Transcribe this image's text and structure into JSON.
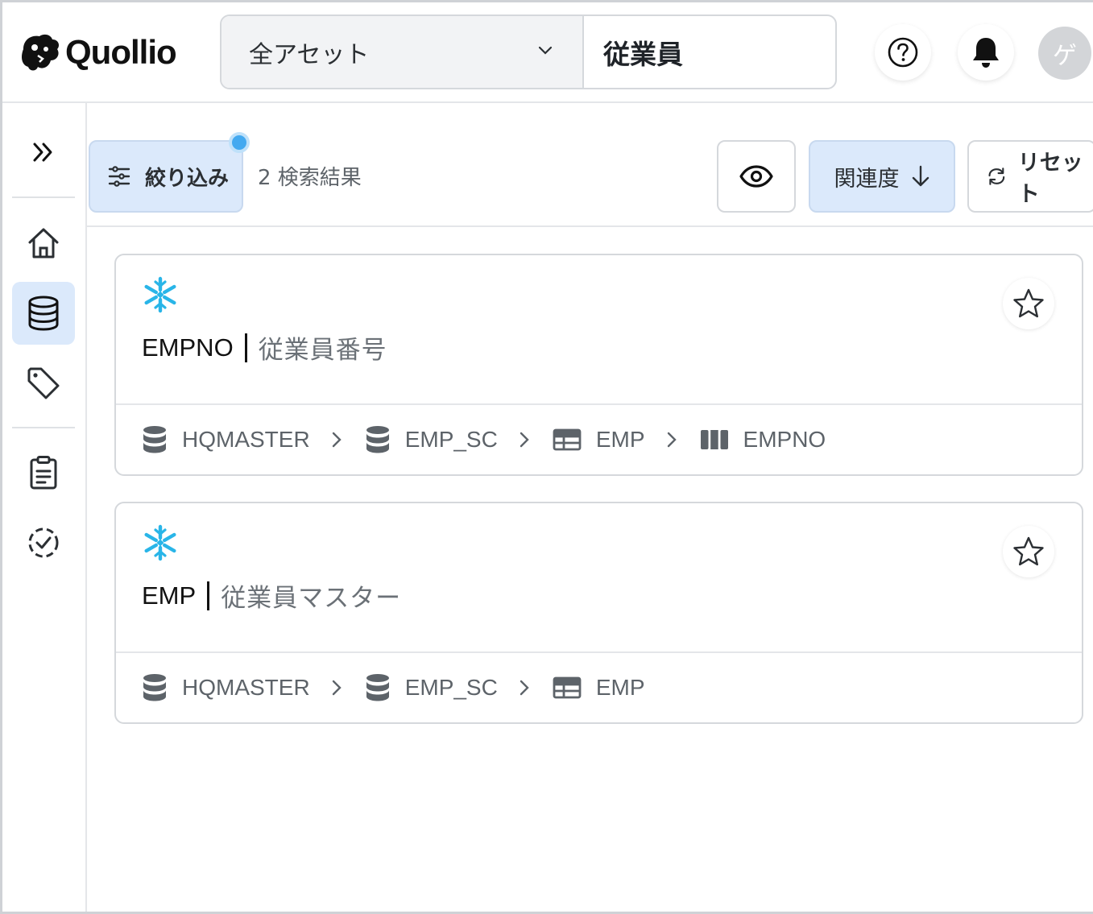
{
  "header": {
    "logo_text": "Quollio",
    "scope_label": "全アセット",
    "search_value": "従業員",
    "avatar_initial": "ゲ"
  },
  "toolbar": {
    "filter_label": "絞り込み",
    "result_count": "2 検索結果",
    "sort_label": "関連度",
    "reset_label": "リセット"
  },
  "results": [
    {
      "name": "EMPNO",
      "description": "従業員番号",
      "path": [
        {
          "type": "database",
          "label": "HQMASTER"
        },
        {
          "type": "schema",
          "label": "EMP_SC"
        },
        {
          "type": "table",
          "label": "EMP"
        },
        {
          "type": "column",
          "label": "EMPNO"
        }
      ]
    },
    {
      "name": "EMP",
      "description": "従業員マスター",
      "path": [
        {
          "type": "database",
          "label": "HQMASTER"
        },
        {
          "type": "schema",
          "label": "EMP_SC"
        },
        {
          "type": "table",
          "label": "EMP"
        }
      ]
    }
  ],
  "colors": {
    "accent_bg": "#dbe9fb",
    "snowflake": "#29b5e8",
    "notification_dot": "#43a9f0"
  }
}
